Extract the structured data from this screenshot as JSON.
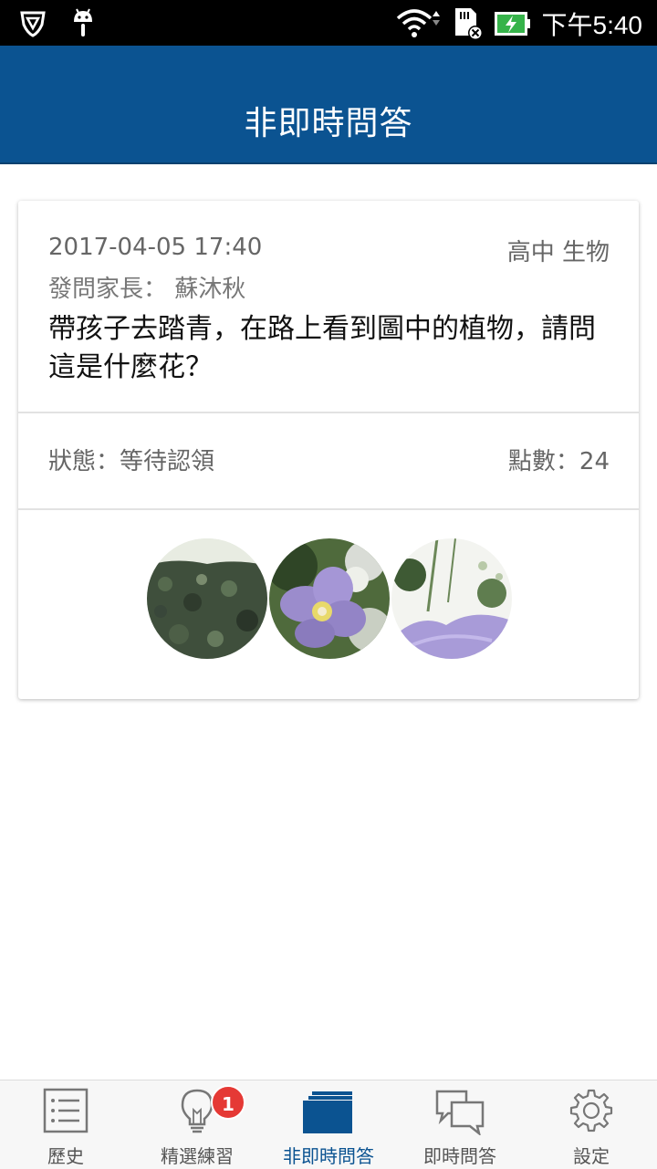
{
  "status_bar": {
    "time": "下午5:40",
    "icons": [
      "shield-icon",
      "android-icon",
      "wifi-icon",
      "sim-card-icon",
      "battery-charging-icon"
    ]
  },
  "app_bar": {
    "title": "非即時問答"
  },
  "question_card": {
    "date": "2017-04-05 17:40",
    "subject": "高中 生物",
    "asker": "發問家長： 蘇沐秋",
    "question": "帶孩子去踏青，在路上看到圖中的植物，請問這是什麼花？",
    "status": "狀態：等待認領",
    "points": "點數：24",
    "photos": [
      "hedge-photo",
      "purple-flower-photo",
      "purple-flower-closeup-photo"
    ]
  },
  "bottom_nav": {
    "items": [
      {
        "label": "歷史",
        "icon": "list-icon",
        "active": false
      },
      {
        "label": "精選練習",
        "icon": "lightbulb-icon",
        "active": false
      },
      {
        "label": "非即時問答",
        "icon": "stack-icon",
        "active": true
      },
      {
        "label": "即時問答",
        "icon": "chat-bubbles-icon",
        "active": false
      },
      {
        "label": "設定",
        "icon": "gear-icon",
        "active": false
      }
    ],
    "badge_count": "1"
  },
  "colors": {
    "primary": "#0b5391",
    "badge": "#e53935",
    "status_bar": "#000000"
  }
}
